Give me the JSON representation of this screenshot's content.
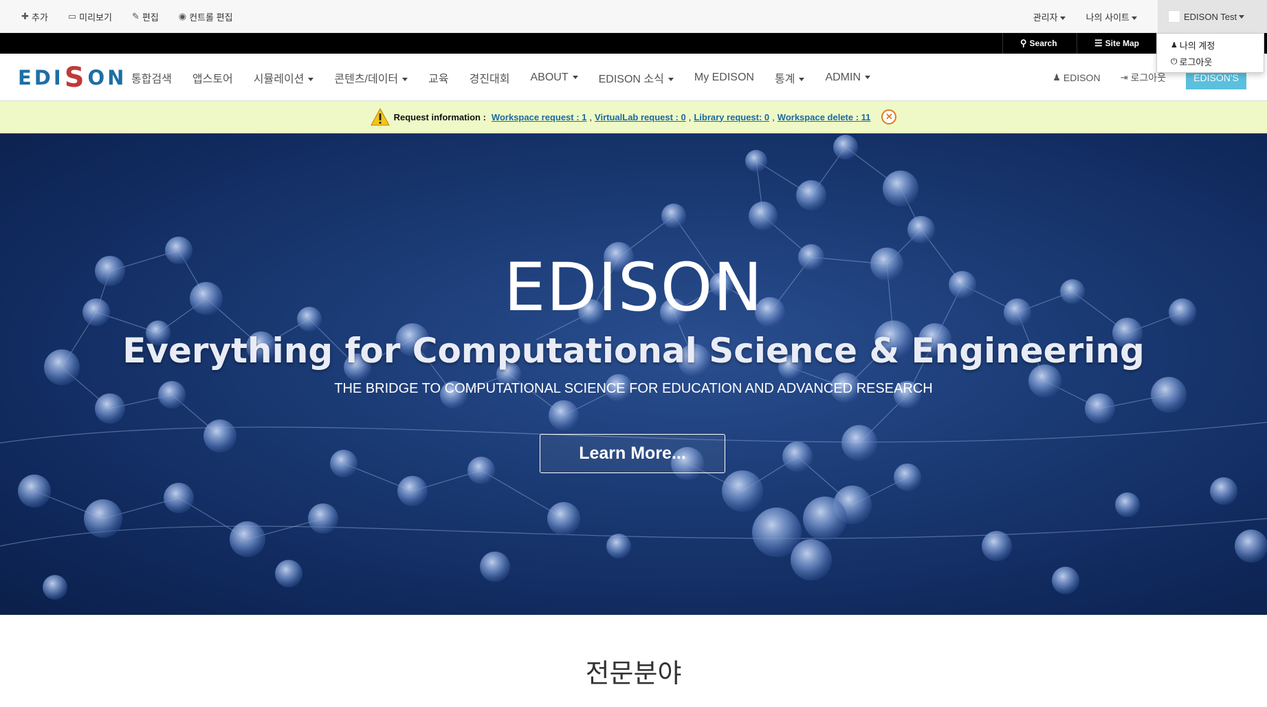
{
  "admin_bar": {
    "left_items": [
      {
        "icon": "plus-icon",
        "glyph": "✚",
        "label": "추가"
      },
      {
        "icon": "monitor-icon",
        "glyph": "▭",
        "label": "미리보기"
      },
      {
        "icon": "edit-icon",
        "glyph": "✎",
        "label": "편집"
      },
      {
        "icon": "eye-icon",
        "glyph": "◉",
        "label": "컨트롤 편집"
      }
    ],
    "right_items": [
      {
        "label": "관리자"
      },
      {
        "label": "나의 사이트"
      }
    ],
    "user": {
      "label": "EDISON Test"
    }
  },
  "user_dropdown": {
    "items": [
      {
        "icon": "user-icon",
        "glyph": "👤",
        "label": "나의 계정"
      },
      {
        "icon": "power-icon",
        "glyph": "⏻",
        "label": "로그아웃"
      }
    ]
  },
  "black_bar": {
    "search_label": "Search",
    "sitemap_label": "Site Map"
  },
  "navbar": {
    "logo_parts": [
      "EDI",
      "S",
      "ON"
    ],
    "items": [
      {
        "label": "통합검색",
        "dropdown": false
      },
      {
        "label": "앱스토어",
        "dropdown": false
      },
      {
        "label": "시뮬레이션",
        "dropdown": true
      },
      {
        "label": "콘텐츠/데이터",
        "dropdown": true
      },
      {
        "label": "교육",
        "dropdown": false
      },
      {
        "label": "경진대회",
        "dropdown": false
      },
      {
        "label": "ABOUT",
        "dropdown": true
      },
      {
        "label": "EDISON 소식",
        "dropdown": true
      },
      {
        "label": "My EDISON",
        "dropdown": false
      },
      {
        "label": "통계",
        "dropdown": true
      },
      {
        "label": "ADMIN",
        "dropdown": true
      }
    ],
    "right_user_label": "EDISON",
    "right_logout_label": "로그아웃",
    "edisons_button": "EDISON'S"
  },
  "alert": {
    "prefix": "Request information :",
    "links": [
      "Workspace request : 1",
      "VirtualLab request : 0",
      "Library request: 0",
      "Workspace delete : 11"
    ],
    "separator": ","
  },
  "hero": {
    "title": "EDISON",
    "subtitle": "Everything for Computational Science & Engineering",
    "tagline": "THE BRIDGE TO COMPUTATIONAL SCIENCE FOR EDUCATION AND ADVANCED RESEARCH",
    "button": "Learn More..."
  },
  "section": {
    "title": "전문분야"
  },
  "colors": {
    "accent": "#5bc0de",
    "link": "#1b6aa0",
    "alert_bg": "#eef9c7",
    "hero_bg": "#1a3a74"
  }
}
